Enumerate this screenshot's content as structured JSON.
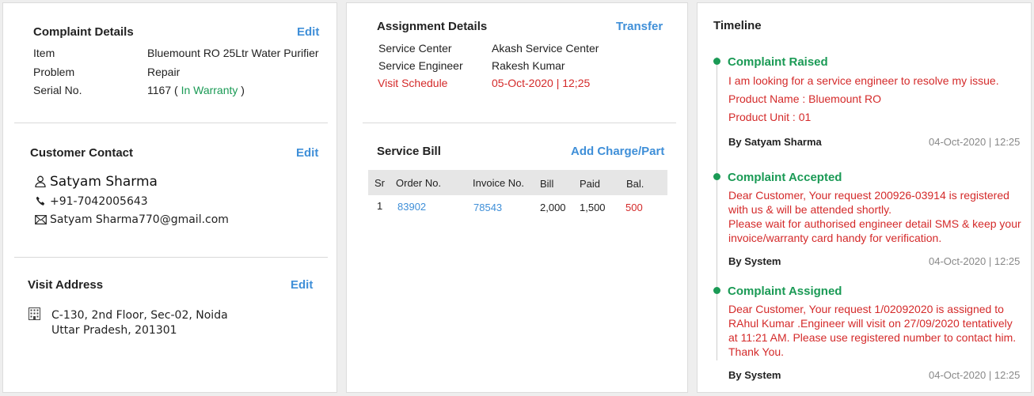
{
  "complaint": {
    "title": "Complaint Details",
    "edit": "Edit",
    "item_label": "Item",
    "item_value": "Bluemount RO 25Ltr Water Purifier",
    "problem_label": "Problem",
    "problem_value": "Repair",
    "serial_label": "Serial No.",
    "serial_value": "1167 (",
    "serial_warranty": "In Warranty",
    "serial_close": ")"
  },
  "contact": {
    "title": "Customer Contact",
    "edit": "Edit",
    "name": "Satyam Sharma",
    "phone": "+91-7042005643",
    "email": "Satyam Sharma770@gmail.com",
    "icons": [
      "user-icon",
      "phone-icon",
      "mail-icon"
    ]
  },
  "address": {
    "title": "Visit Address",
    "edit": "Edit",
    "line1": "C-130, 2nd Floor, Sec-02, Noida",
    "line2": "Uttar Pradesh, 201301",
    "icon": "building-icon"
  },
  "assignment": {
    "title": "Assignment Details",
    "transfer": "Transfer",
    "center_label": "Service Center",
    "center_value": "Akash Service Center",
    "engineer_label": "Service Engineer",
    "engineer_value": "Rakesh Kumar",
    "visit_label": "Visit Schedule",
    "visit_value": "05-Oct-2020 | 12;25"
  },
  "bill": {
    "title": "Service Bill",
    "add": "Add Charge/Part",
    "headers": [
      "Sr",
      "Order No.",
      "Invoice No.",
      "Bill",
      "Paid",
      "Bal."
    ],
    "rows": [
      {
        "sr": "1",
        "order": "83902",
        "invoice": "78543",
        "bill": "2,000",
        "paid": "1,500",
        "bal": "500"
      }
    ]
  },
  "timeline": {
    "title": "Timeline",
    "events": [
      {
        "title": "Complaint Raised",
        "lines": [
          "I am looking for a service engineer to resolve my issue.",
          "Product Name : Bluemount RO",
          "Product Unit : 01"
        ],
        "by": "By Satyam Sharma",
        "time": "04-Oct-2020 | 12:25"
      },
      {
        "title": "Complaint Accepted",
        "lines": [
          "Dear Customer, Your request 200926-03914 is registered with us & will be attended shortly.",
          "Please wait for authorised engineer detail SMS & keep your invoice/warranty card handy for verification."
        ],
        "by": "By System",
        "time": "04-Oct-2020 | 12:25"
      },
      {
        "title": "Complaint Assigned",
        "lines": [
          "Dear Customer, Your request 1/02092020 is assigned to RAhul Kumar .Engineer will visit on 27/09/2020 tentatively at 11:21 AM. Please use registered number to contact him. Thank You."
        ],
        "by": "By System",
        "time": "04-Oct-2020 | 12:25"
      }
    ]
  },
  "colors": {
    "accent": "#3f8fd8",
    "success": "#1a9a55",
    "danger": "#d42a2a"
  }
}
